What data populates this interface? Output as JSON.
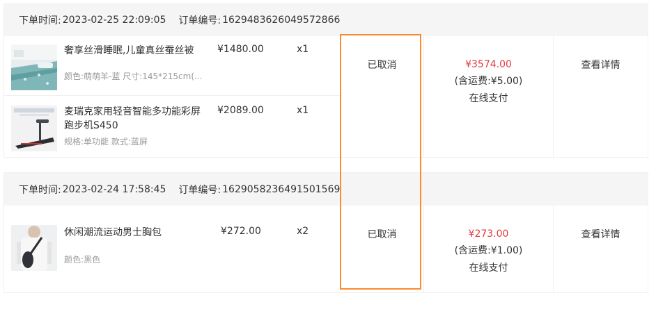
{
  "labels": {
    "order_time": "下单时间:",
    "order_no": "订单编号:",
    "view_detail": "查看详情"
  },
  "orders": [
    {
      "time": "2023-02-25 22:09:05",
      "number": "1629483626049572866",
      "status": "已取消",
      "total": "¥3574.00",
      "shipping": "(含运费:¥5.00)",
      "payment": "在线支付",
      "items": [
        {
          "name": "奢享丝滑睡眠,儿童真丝蚕丝被",
          "spec": "颜色:萌萌羊-蓝 尺寸:145*215cm(...",
          "price": "¥1480.00",
          "qty": "x1",
          "thumb_icon": "bedding-product-image"
        },
        {
          "name": "麦瑞克家用轻音智能多功能彩屏跑步机S450",
          "spec": "规格:单功能 款式:蓝屏",
          "price": "¥2089.00",
          "qty": "x1",
          "thumb_icon": "treadmill-product-image"
        }
      ]
    },
    {
      "time": "2023-02-24 17:58:45",
      "number": "1629058236491501569",
      "status": "已取消",
      "total": "¥273.00",
      "shipping": "(含运费:¥1.00)",
      "payment": "在线支付",
      "items": [
        {
          "name": "休闲潮流运动男士胸包",
          "spec": "颜色:黑色",
          "price": "¥272.00",
          "qty": "x2",
          "thumb_icon": "chest-bag-product-image"
        }
      ]
    }
  ],
  "colors": {
    "accent_red": "#e4393c",
    "highlight_orange": "#ff8a2c",
    "header_bg": "#f5f5f5"
  }
}
